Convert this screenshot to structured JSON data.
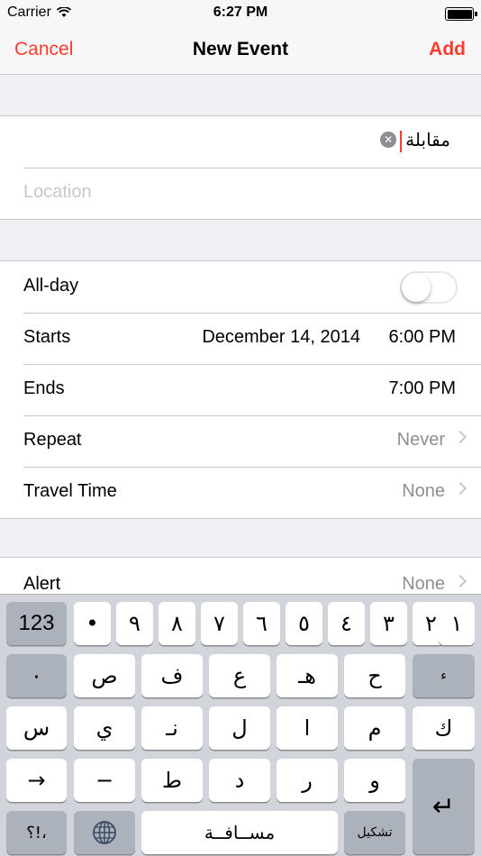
{
  "status": {
    "carrier": "Carrier",
    "time": "6:27 PM"
  },
  "nav": {
    "cancel": "Cancel",
    "title": "New Event",
    "add": "Add"
  },
  "form": {
    "title_value": "مقابلة",
    "location_placeholder": "Location",
    "allday_label": "All-day",
    "allday_on": false,
    "starts_label": "Starts",
    "starts_date": "December 14, 2014",
    "starts_time": "6:00 PM",
    "ends_label": "Ends",
    "ends_time": "7:00 PM",
    "repeat_label": "Repeat",
    "repeat_value": "Never",
    "travel_label": "Travel Time",
    "travel_value": "None",
    "alert_label": "Alert",
    "alert_value": "None"
  },
  "keyboard": {
    "row1": [
      "123",
      "•",
      "٩",
      "٨",
      "٧",
      "٦",
      "٥",
      "٤",
      "٣",
      "٢",
      "١"
    ],
    "row2": [
      "٠",
      "ص",
      "ف",
      "ع",
      "هـ",
      "ح",
      "ء"
    ],
    "row3": [
      "س",
      "ي",
      "نـ",
      "ل",
      "ا",
      "م",
      "ك"
    ],
    "row4": [
      "→",
      "−",
      "ط",
      "د",
      "ر",
      "و",
      "↵"
    ],
    "row5": [
      "؟!،",
      "🌐",
      "مســافــة",
      "تشكيل"
    ]
  }
}
